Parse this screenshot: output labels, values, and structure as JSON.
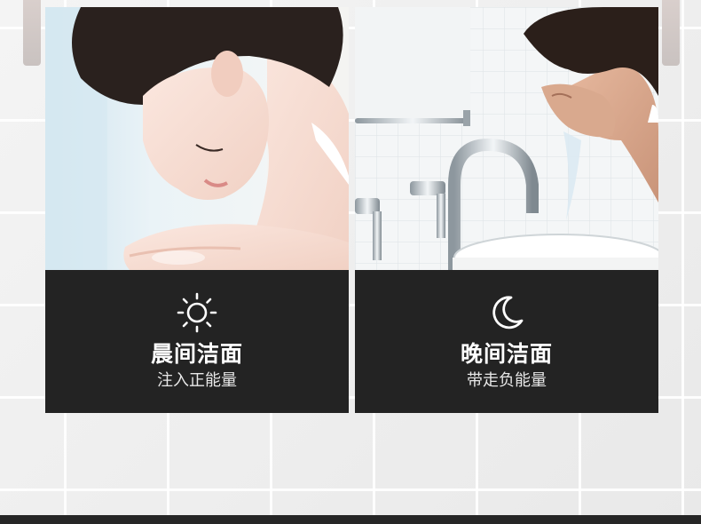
{
  "colors": {
    "card_background": "#232323",
    "text": "#ffffff",
    "wall": "#eeeeee",
    "bottom_bar": "#262626"
  },
  "cards": [
    {
      "icon": "sun-icon",
      "title": "晨间洁面",
      "subtitle": "注入正能量"
    },
    {
      "icon": "moon-icon",
      "title": "晚间洁面",
      "subtitle": "带走负能量"
    }
  ]
}
